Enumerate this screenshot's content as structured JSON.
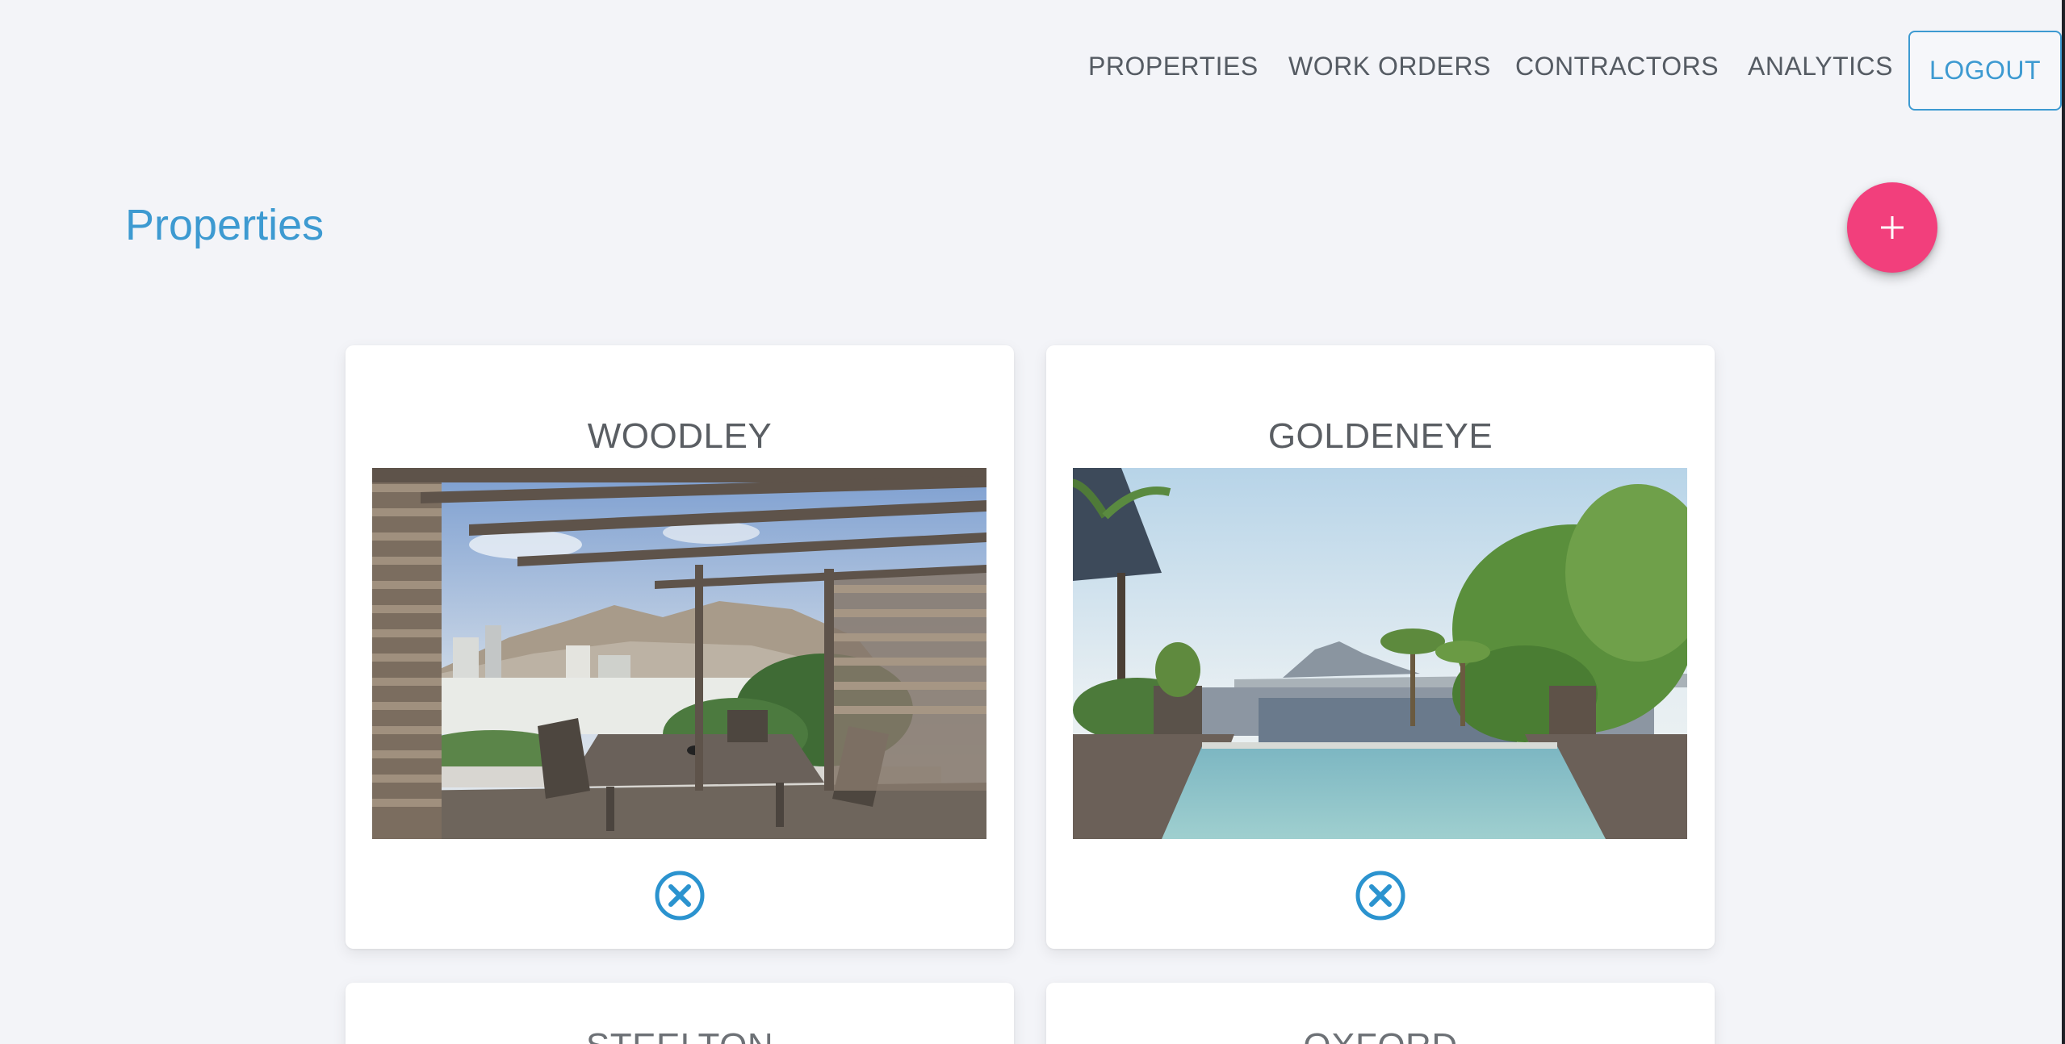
{
  "nav": {
    "items": [
      {
        "label": "PROPERTIES"
      },
      {
        "label": "WORK ORDERS"
      },
      {
        "label": "CONTRACTORS"
      },
      {
        "label": "ANALYTICS"
      }
    ],
    "logout_label": "LOGOUT"
  },
  "header": {
    "title": "Properties",
    "add_button_icon": "plus-icon"
  },
  "properties": [
    {
      "name": "WOODLEY",
      "image": "rooftop-pergola-terrace-photo",
      "action_icon": "close-circle-icon"
    },
    {
      "name": "GOLDENEYE",
      "image": "infinity-pool-mountain-view-photo",
      "action_icon": "close-circle-icon"
    },
    {
      "name": "STEELTON"
    },
    {
      "name": "OXFORD"
    }
  ],
  "colors": {
    "accent": "#3d9ad1",
    "fab": "#f23f7c",
    "background": "#f3f4f8",
    "card": "#ffffff",
    "nav_text": "#555b63"
  }
}
